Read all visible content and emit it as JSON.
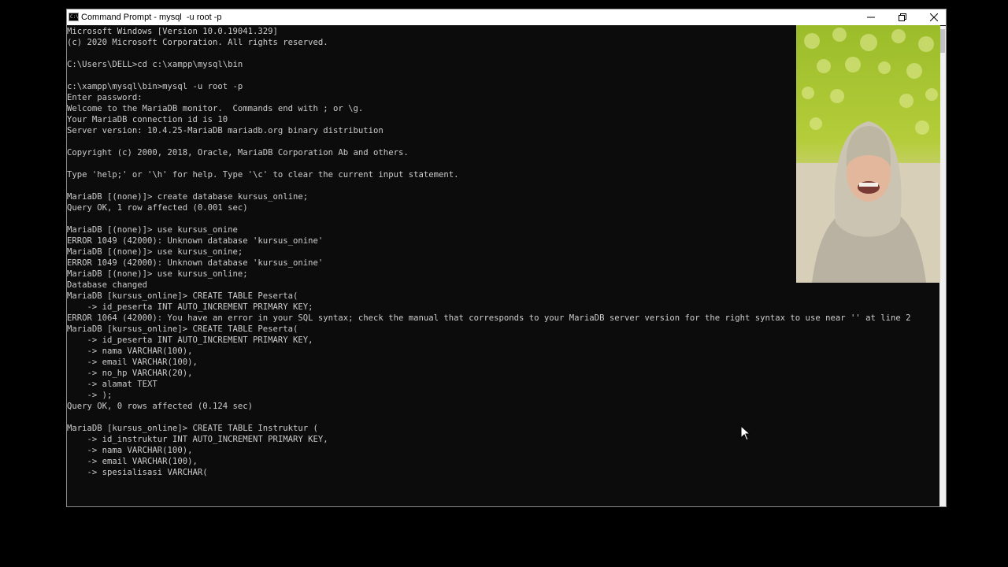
{
  "window": {
    "title": "Command Prompt - mysql  -u root -p",
    "icon_text": "C:\\",
    "icons": {
      "minimize": "minimize-icon",
      "maximize": "restore-icon",
      "close": "close-icon"
    }
  },
  "terminal": {
    "lines": [
      "Microsoft Windows [Version 10.0.19041.329]",
      "(c) 2020 Microsoft Corporation. All rights reserved.",
      "",
      "C:\\Users\\DELL>cd c:\\xampp\\mysql\\bin",
      "",
      "c:\\xampp\\mysql\\bin>mysql -u root -p",
      "Enter password:",
      "Welcome to the MariaDB monitor.  Commands end with ; or \\g.",
      "Your MariaDB connection id is 10",
      "Server version: 10.4.25-MariaDB mariadb.org binary distribution",
      "",
      "Copyright (c) 2000, 2018, Oracle, MariaDB Corporation Ab and others.",
      "",
      "Type 'help;' or '\\h' for help. Type '\\c' to clear the current input statement.",
      "",
      "MariaDB [(none)]> create database kursus_online;",
      "Query OK, 1 row affected (0.001 sec)",
      "",
      "MariaDB [(none)]> use kursus_onine",
      "ERROR 1049 (42000): Unknown database 'kursus_onine'",
      "MariaDB [(none)]> use kursus_onine;",
      "ERROR 1049 (42000): Unknown database 'kursus_onine'",
      "MariaDB [(none)]> use kursus_online;",
      "Database changed",
      "MariaDB [kursus_online]> CREATE TABLE Peserta(",
      "    -> id_peserta INT AUTO_INCREMENT PRIMARY KEY;",
      "ERROR 1064 (42000): You have an error in your SQL syntax; check the manual that corresponds to your MariaDB server version for the right syntax to use near '' at line 2",
      "MariaDB [kursus_online]> CREATE TABLE Peserta(",
      "    -> id_peserta INT AUTO_INCREMENT PRIMARY KEY,",
      "    -> nama VARCHAR(100),",
      "    -> email VARCHAR(100),",
      "    -> no_hp VARCHAR(20),",
      "    -> alamat TEXT",
      "    -> );",
      "Query OK, 0 rows affected (0.124 sec)",
      "",
      "MariaDB [kursus_online]> CREATE TABLE Instruktur (",
      "    -> id_instruktur INT AUTO_INCREMENT PRIMARY KEY,",
      "    -> nama VARCHAR(100),",
      "    -> email VARCHAR(100),",
      "    -> spesialisasi VARCHAR("
    ]
  },
  "colors": {
    "terminal_bg": "#0c0c0c",
    "terminal_text": "#cccccc",
    "titlebar_bg": "#ffffff"
  },
  "cursor": {
    "icon": "mouse-pointer-icon"
  }
}
